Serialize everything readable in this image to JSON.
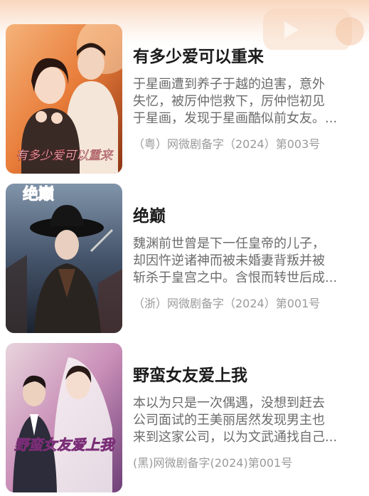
{
  "dramas": [
    {
      "title": "有多少爱可以重来",
      "description_lines": [
        "于星画遭到养子于越的迫害，意外",
        "失忆，被厉仲恺救下，厉仲恺初见",
        "于星画，发现于星画酷似前女友。..."
      ],
      "registration": "（粤）网微剧备字（2024）第003号",
      "poster_text": "有多少爱可以重来",
      "poster_colors": [
        "#e86a2a",
        "#f4b57a"
      ]
    },
    {
      "title": "绝巅",
      "description_lines": [
        "魏渊前世曾是下一任皇帝的儿子，",
        "却因忤逆诸神而被未婚妻背叛并被",
        "斩杀于皇宫之中。含恨而转世后成..."
      ],
      "registration": "（浙）网微剧备字（2024）第001号",
      "poster_text": "绝巅",
      "poster_colors": [
        "#2e3a4c",
        "#7b8ea3"
      ]
    },
    {
      "title": "野蛮女友爱上我",
      "description_lines": [
        "本以为只是一次偶遇，没想到赶去",
        "公司面试的王美丽居然发现男主也",
        "来到这家公司，以为文武通找自己..."
      ],
      "registration": "(黑)网微剧备字(2024)第001号",
      "poster_text": "野蛮女友爱上我",
      "poster_colors": [
        "#b46aa6",
        "#f1d7e3"
      ]
    }
  ]
}
